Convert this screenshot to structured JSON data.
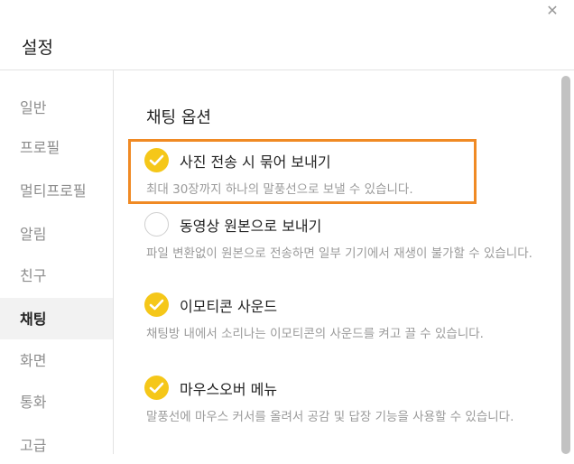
{
  "window": {
    "title": "설정",
    "close_icon": "close-icon"
  },
  "sidebar": {
    "items": [
      {
        "label": "일반",
        "active": false
      },
      {
        "label": "프로필",
        "active": false
      },
      {
        "label": "멀티프로필",
        "active": false
      },
      {
        "label": "알림",
        "active": false
      },
      {
        "label": "친구",
        "active": false
      },
      {
        "label": "채팅",
        "active": true
      },
      {
        "label": "화면",
        "active": false
      },
      {
        "label": "통화",
        "active": false
      },
      {
        "label": "고급",
        "active": false
      }
    ]
  },
  "main": {
    "section_title": "채팅 옵션",
    "options": [
      {
        "label": "사진 전송 시 묶어 보내기",
        "description": "최대 30장까지 하나의 말풍선으로 보낼 수 있습니다.",
        "checked": true,
        "highlighted": true
      },
      {
        "label": "동영상 원본으로 보내기",
        "description": "파일 변환없이 원본으로 전송하면 일부 기기에서 재생이 불가할 수 있습니다.",
        "checked": false,
        "highlighted": false
      },
      {
        "label": "이모티콘 사운드",
        "description": "채팅방 내에서 소리나는 이모티콘의 사운드를 켜고 끌 수 있습니다.",
        "checked": true,
        "highlighted": false
      },
      {
        "label": "마우스오버 메뉴",
        "description": "말풍선에 마우스 커서를 올려서 공감 및 답장 기능을 사용할 수 있습니다.",
        "checked": true,
        "highlighted": false
      }
    ]
  },
  "colors": {
    "accent_check": "#f5c719",
    "highlight_border": "#f08a24",
    "active_sidebar_bg": "#f2f2f2"
  }
}
